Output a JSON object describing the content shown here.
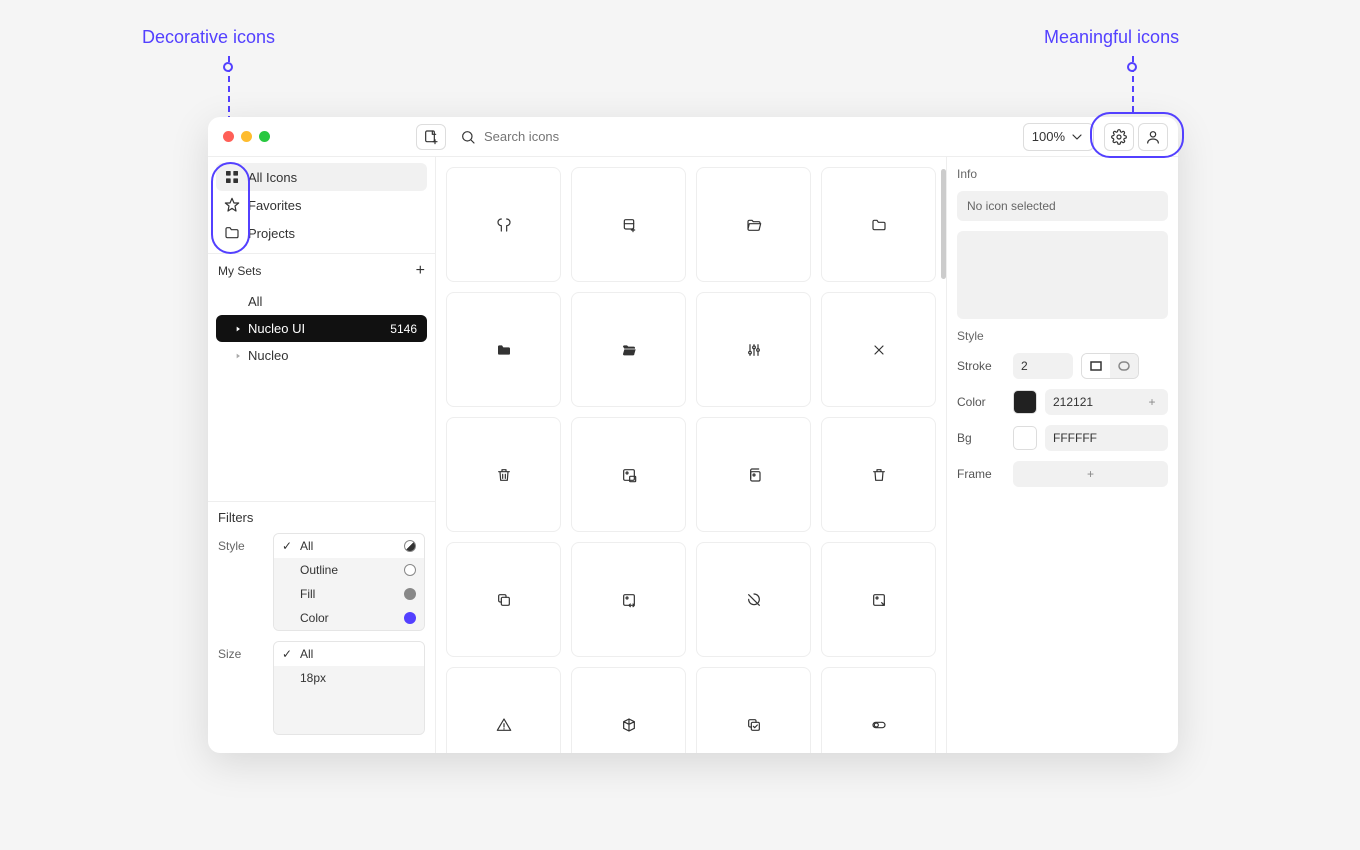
{
  "annotations": {
    "left": "Decorative icons",
    "right": "Meaningful icons"
  },
  "toolbar": {
    "search_placeholder": "Search icons",
    "zoom": "100%"
  },
  "sidebar": {
    "nav": [
      {
        "label": "All Icons",
        "active": true
      },
      {
        "label": "Favorites",
        "active": false
      },
      {
        "label": "Projects",
        "active": false
      }
    ],
    "my_sets_label": "My Sets",
    "sets": [
      {
        "label": "All",
        "active": false,
        "count": ""
      },
      {
        "label": "Nucleo UI",
        "active": true,
        "count": "5146"
      },
      {
        "label": "Nucleo",
        "active": false,
        "count": ""
      }
    ]
  },
  "filters": {
    "title": "Filters",
    "style_label": "Style",
    "style_options": [
      {
        "label": "All",
        "selected": true,
        "swatch": "all"
      },
      {
        "label": "Outline",
        "selected": false,
        "swatch": "outline"
      },
      {
        "label": "Fill",
        "selected": false,
        "swatch": "fill"
      },
      {
        "label": "Color",
        "selected": false,
        "swatch": "color"
      }
    ],
    "size_label": "Size",
    "size_options": [
      {
        "label": "All",
        "selected": true
      },
      {
        "label": "18px",
        "selected": false
      }
    ]
  },
  "inspector": {
    "info_label": "Info",
    "no_icon": "No icon selected",
    "style_label": "Style",
    "stroke_label": "Stroke",
    "stroke_value": "2",
    "color_label": "Color",
    "color_value": "212121",
    "bg_label": "Bg",
    "bg_value": "FFFFFF",
    "frame_label": "Frame"
  },
  "grid_icons": [
    "wrench",
    "db-add",
    "folder-open-outline",
    "folder-outline",
    "folder-fill",
    "folder-open-fill",
    "sliders",
    "close",
    "trash",
    "image-pop",
    "image-front",
    "trash-outline",
    "copy",
    "image-code",
    "leaf-off",
    "image-expand",
    "warning",
    "cube",
    "copy-check",
    "pill"
  ]
}
